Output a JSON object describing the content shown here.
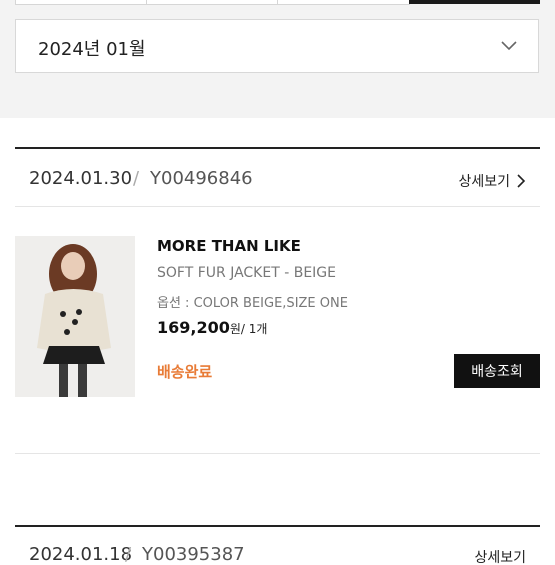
{
  "filter": {
    "month_label": "2024년 01월"
  },
  "orders": [
    {
      "date": "2024.01.30",
      "separator": "/",
      "order_number": "Y00496846",
      "detail_label": "상세보기",
      "item": {
        "brand": "MORE THAN LIKE",
        "name": "SOFT FUR JACKET - BEIGE",
        "option": "옵션 : COLOR BEIGE,SIZE ONE",
        "price": "169,200",
        "price_unit": "원/ 1개",
        "status": "배송완료",
        "track_label": "배송조회"
      }
    },
    {
      "date": "2024.01.18",
      "separator": "/",
      "order_number": "Y00395387",
      "detail_label": "상세보기"
    }
  ],
  "colors": {
    "status": "#e87b36",
    "accent": "#111111"
  }
}
